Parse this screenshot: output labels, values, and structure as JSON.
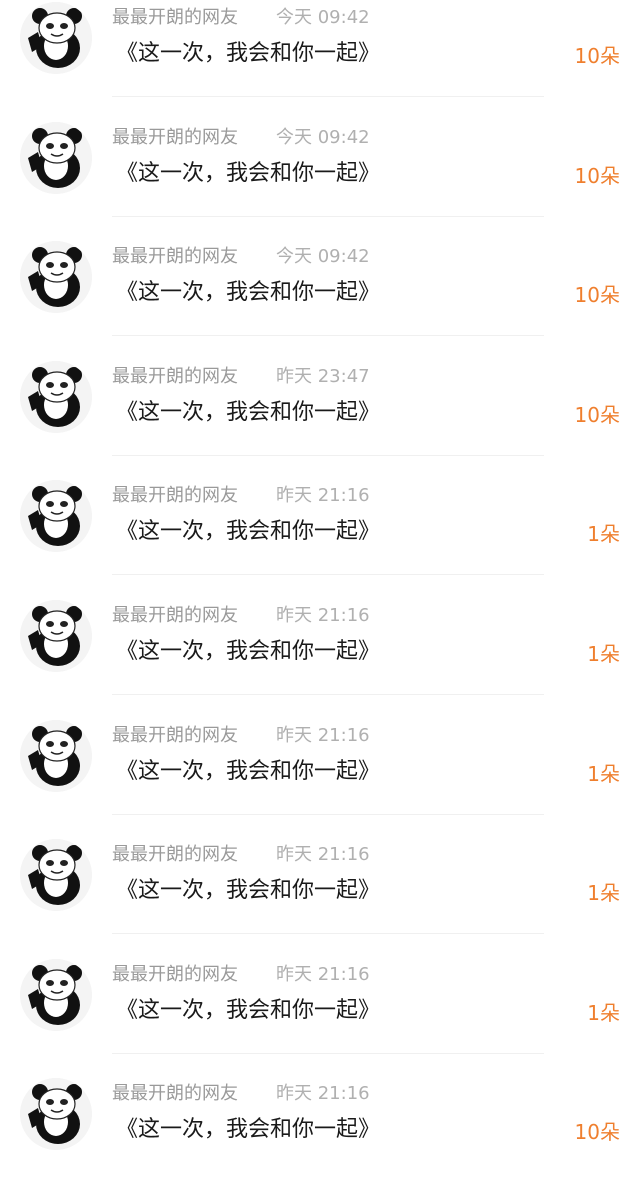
{
  "accent_color": "#ef7f2e",
  "avatar_icon": "panda-meme-avatar-icon",
  "rows": [
    {
      "username": "最最开朗的网友",
      "time": "今天 09:42",
      "gift": "《这一次，我会和你一起》",
      "count": "10朵"
    },
    {
      "username": "最最开朗的网友",
      "time": "今天 09:42",
      "gift": "《这一次，我会和你一起》",
      "count": "10朵"
    },
    {
      "username": "最最开朗的网友",
      "time": "今天 09:42",
      "gift": "《这一次，我会和你一起》",
      "count": "10朵"
    },
    {
      "username": "最最开朗的网友",
      "time": "昨天 23:47",
      "gift": "《这一次，我会和你一起》",
      "count": "10朵"
    },
    {
      "username": "最最开朗的网友",
      "time": "昨天 21:16",
      "gift": "《这一次，我会和你一起》",
      "count": "1朵"
    },
    {
      "username": "最最开朗的网友",
      "time": "昨天 21:16",
      "gift": "《这一次，我会和你一起》",
      "count": "1朵"
    },
    {
      "username": "最最开朗的网友",
      "time": "昨天 21:16",
      "gift": "《这一次，我会和你一起》",
      "count": "1朵"
    },
    {
      "username": "最最开朗的网友",
      "time": "昨天 21:16",
      "gift": "《这一次，我会和你一起》",
      "count": "1朵"
    },
    {
      "username": "最最开朗的网友",
      "time": "昨天 21:16",
      "gift": "《这一次，我会和你一起》",
      "count": "1朵"
    },
    {
      "username": "最最开朗的网友",
      "time": "昨天 21:16",
      "gift": "《这一次，我会和你一起》",
      "count": "10朵"
    }
  ]
}
